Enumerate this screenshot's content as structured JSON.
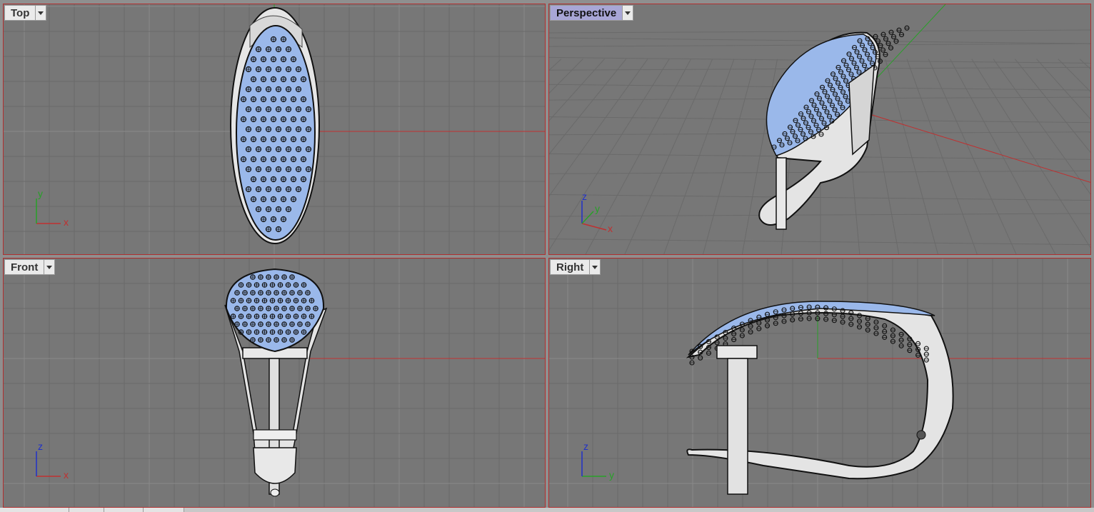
{
  "viewports": {
    "top": {
      "label": "Top",
      "axis_h": "x",
      "axis_v": "y"
    },
    "perspective": {
      "label": "Perspective",
      "axis_h": "x",
      "axis_v": "z",
      "axis_d": "y"
    },
    "front": {
      "label": "Front",
      "axis_h": "x",
      "axis_v": "z"
    },
    "right": {
      "label": "Right",
      "axis_h": "y",
      "axis_v": "z"
    }
  },
  "colors": {
    "viewport_bg": "#777777",
    "grid_minor": "#6a6a6a",
    "grid_major": "#8a8a8a",
    "border": "#b03030",
    "axis_x": "#c03030",
    "axis_y": "#28a028",
    "axis_z": "#2030c8",
    "gem": "#9ab8ea",
    "metal": "#e6e6e6",
    "active_tab": "#a8a6d6"
  }
}
